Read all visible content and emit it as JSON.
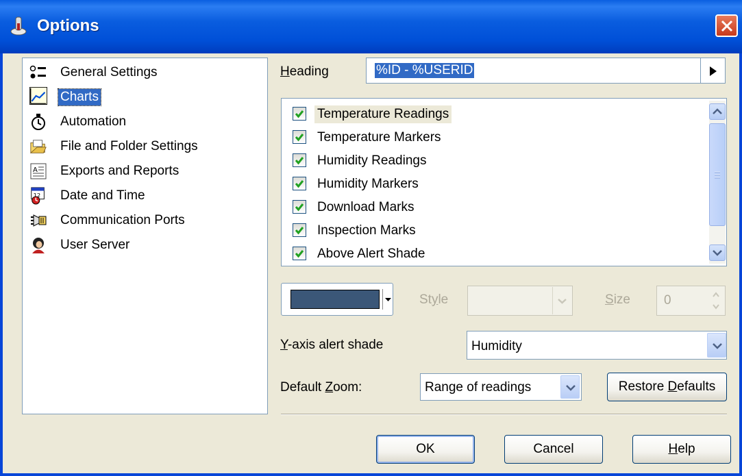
{
  "window": {
    "title": "Options",
    "close_icon": "close-x-icon"
  },
  "sidebar": {
    "items": [
      {
        "label": "General Settings",
        "icon": "general-settings-icon",
        "selected": false
      },
      {
        "label": "Charts",
        "icon": "chart-line-icon",
        "selected": true
      },
      {
        "label": "Automation",
        "icon": "stopwatch-icon",
        "selected": false
      },
      {
        "label": "File and Folder Settings",
        "icon": "folder-icon",
        "selected": false
      },
      {
        "label": "Exports and Reports",
        "icon": "report-icon",
        "selected": false
      },
      {
        "label": "Date and Time",
        "icon": "calendar-clock-icon",
        "selected": false
      },
      {
        "label": "Communication Ports",
        "icon": "comm-port-icon",
        "selected": false
      },
      {
        "label": "User Server",
        "icon": "user-server-icon",
        "selected": false
      }
    ]
  },
  "heading": {
    "label_prefix": "H",
    "label_rest": "eading",
    "value": "%ID - %USERID",
    "insert_button_icon": "triangle-right-icon"
  },
  "chart_items": [
    {
      "label": "Temperature Readings",
      "checked": true
    },
    {
      "label": "Temperature Markers",
      "checked": true
    },
    {
      "label": "Humidity Readings",
      "checked": true
    },
    {
      "label": "Humidity Markers",
      "checked": true
    },
    {
      "label": "Download Marks",
      "checked": true
    },
    {
      "label": "Inspection Marks",
      "checked": true
    },
    {
      "label": "Above Alert Shade",
      "checked": true
    }
  ],
  "color_picker": {
    "color": "#3b5778"
  },
  "style": {
    "label_prefix": "St",
    "label_key": "y",
    "label_rest": "le",
    "value": ""
  },
  "size": {
    "label_key": "S",
    "label_rest": "ize",
    "value": "0"
  },
  "y_axis_alert_shade": {
    "label_key": "Y",
    "label_rest": "-axis alert shade",
    "value": "Humidity"
  },
  "default_zoom": {
    "label_prefix": "Default ",
    "label_key": "Z",
    "label_rest": "oom:",
    "value": "Range of readings"
  },
  "buttons": {
    "restore_prefix": "Restore ",
    "restore_key": "D",
    "restore_rest": "efaults",
    "ok": "OK",
    "cancel": "Cancel",
    "help_key": "H",
    "help_rest": "elp"
  },
  "colors": {
    "title_bar": "#0a5ddf",
    "selection": "#316ac5",
    "frame": "#ece9d8"
  }
}
